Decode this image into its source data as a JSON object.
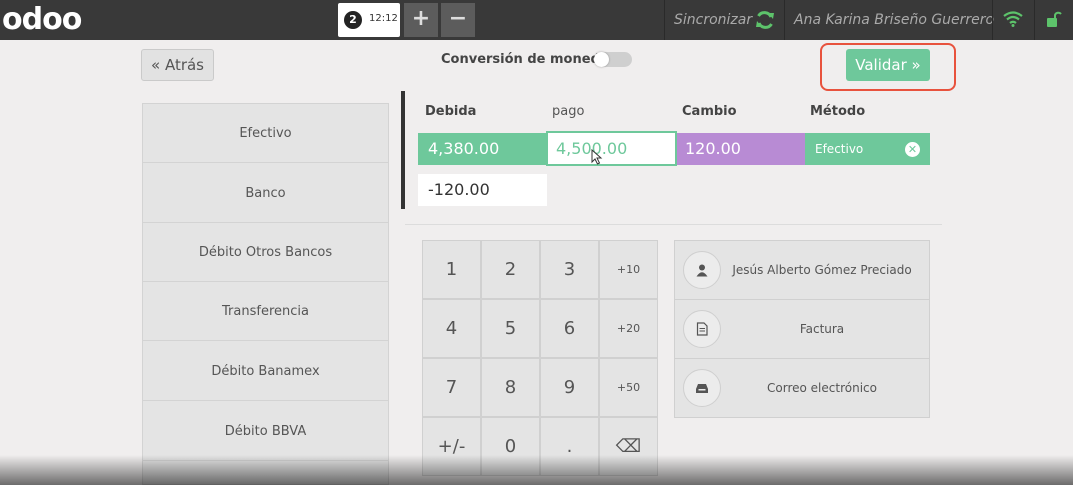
{
  "topbar": {
    "logo": "odoo",
    "order_number": "2",
    "order_time": "12:12",
    "add_label": "+",
    "remove_label": "−",
    "sync_label": "Sincronizar",
    "user_name": "Ana Karina Briseño Guerrero"
  },
  "header": {
    "back_label": "« Atrás",
    "currency_label": "Conversión de monedas",
    "validate_label": "Validar »"
  },
  "payment_methods": [
    "Efectivo",
    "Banco",
    "Débito Otros Bancos",
    "Transferencia",
    "Débito Banamex",
    "Débito BBVA"
  ],
  "payment_lines": {
    "headers": {
      "due": "Debida",
      "tendered": "pago",
      "change": "Cambio",
      "method": "Método"
    },
    "line": {
      "due": "4,380.00",
      "tendered": "4,500.00",
      "change": "120.00",
      "method": "Efectivo"
    },
    "remaining": "-120.00"
  },
  "numpad": {
    "keys": [
      "1",
      "2",
      "3",
      "+10",
      "4",
      "5",
      "6",
      "+20",
      "7",
      "8",
      "9",
      "+50",
      "+/-",
      "0",
      ".",
      "⌫"
    ]
  },
  "customer_actions": {
    "customer": "Jesús Alberto Gómez Preciado",
    "invoice": "Factura",
    "email": "Correo electrónico"
  },
  "colors": {
    "accent_green": "#6ec89b",
    "change_purple": "#b88bd4",
    "topbar": "#393939",
    "highlight_red": "#e8523d"
  },
  "icons": [
    "sync-icon",
    "wifi-icon",
    "lock-icon",
    "user-icon",
    "document-icon",
    "inbox-icon",
    "backspace-icon",
    "close-icon"
  ]
}
